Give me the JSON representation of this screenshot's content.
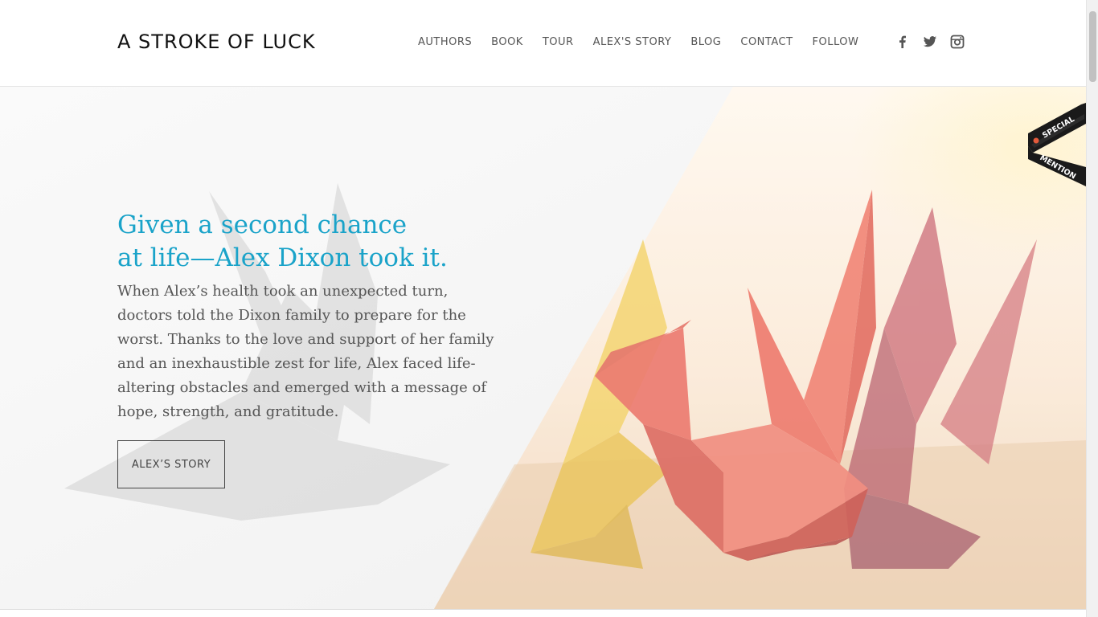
{
  "header": {
    "logo": "A STROKE OF LUCK",
    "nav": [
      "AUTHORS",
      "BOOK",
      "TOUR",
      "ALEX'S STORY",
      "BLOG",
      "CONTACT",
      "FOLLOW"
    ],
    "social": [
      "facebook-icon",
      "twitter-icon",
      "instagram-icon"
    ]
  },
  "hero": {
    "headline_line1": "Given a second chance",
    "headline_line2": "at life—Alex Dixon took it.",
    "body": "When Alex’s health took an unexpected turn, doctors told the Dixon family to prepare for the worst. Thanks to the love and support of her family and an inexhaustible zest for life, Alex faced life-altering obstacles and emerged with a message of hope, strength, and gratitude.",
    "cta_label": "ALEX’S STORY"
  },
  "ribbon": {
    "line1": "SPECIAL",
    "line2": "MENTION"
  },
  "colors": {
    "accent": "#1aa3c9",
    "text": "#555555",
    "crane_red": "#ea6a5e",
    "crane_yellow": "#f2cf5e"
  }
}
